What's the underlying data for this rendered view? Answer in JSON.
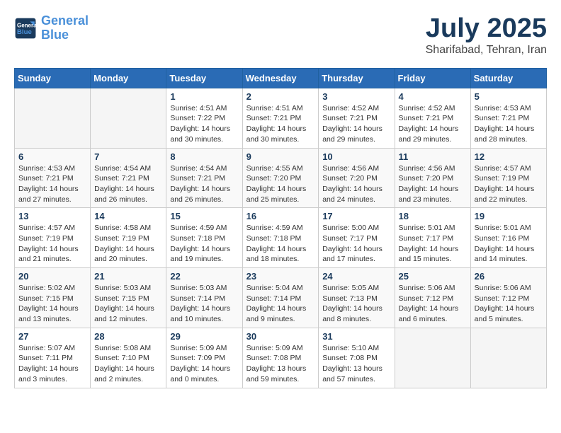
{
  "header": {
    "logo_line1": "General",
    "logo_line2": "Blue",
    "month": "July 2025",
    "location": "Sharifabad, Tehran, Iran"
  },
  "weekdays": [
    "Sunday",
    "Monday",
    "Tuesday",
    "Wednesday",
    "Thursday",
    "Friday",
    "Saturday"
  ],
  "weeks": [
    [
      {
        "day": "",
        "sunrise": "",
        "sunset": "",
        "daylight": ""
      },
      {
        "day": "",
        "sunrise": "",
        "sunset": "",
        "daylight": ""
      },
      {
        "day": "1",
        "sunrise": "Sunrise: 4:51 AM",
        "sunset": "Sunset: 7:22 PM",
        "daylight": "Daylight: 14 hours and 30 minutes."
      },
      {
        "day": "2",
        "sunrise": "Sunrise: 4:51 AM",
        "sunset": "Sunset: 7:21 PM",
        "daylight": "Daylight: 14 hours and 30 minutes."
      },
      {
        "day": "3",
        "sunrise": "Sunrise: 4:52 AM",
        "sunset": "Sunset: 7:21 PM",
        "daylight": "Daylight: 14 hours and 29 minutes."
      },
      {
        "day": "4",
        "sunrise": "Sunrise: 4:52 AM",
        "sunset": "Sunset: 7:21 PM",
        "daylight": "Daylight: 14 hours and 29 minutes."
      },
      {
        "day": "5",
        "sunrise": "Sunrise: 4:53 AM",
        "sunset": "Sunset: 7:21 PM",
        "daylight": "Daylight: 14 hours and 28 minutes."
      }
    ],
    [
      {
        "day": "6",
        "sunrise": "Sunrise: 4:53 AM",
        "sunset": "Sunset: 7:21 PM",
        "daylight": "Daylight: 14 hours and 27 minutes."
      },
      {
        "day": "7",
        "sunrise": "Sunrise: 4:54 AM",
        "sunset": "Sunset: 7:21 PM",
        "daylight": "Daylight: 14 hours and 26 minutes."
      },
      {
        "day": "8",
        "sunrise": "Sunrise: 4:54 AM",
        "sunset": "Sunset: 7:21 PM",
        "daylight": "Daylight: 14 hours and 26 minutes."
      },
      {
        "day": "9",
        "sunrise": "Sunrise: 4:55 AM",
        "sunset": "Sunset: 7:20 PM",
        "daylight": "Daylight: 14 hours and 25 minutes."
      },
      {
        "day": "10",
        "sunrise": "Sunrise: 4:56 AM",
        "sunset": "Sunset: 7:20 PM",
        "daylight": "Daylight: 14 hours and 24 minutes."
      },
      {
        "day": "11",
        "sunrise": "Sunrise: 4:56 AM",
        "sunset": "Sunset: 7:20 PM",
        "daylight": "Daylight: 14 hours and 23 minutes."
      },
      {
        "day": "12",
        "sunrise": "Sunrise: 4:57 AM",
        "sunset": "Sunset: 7:19 PM",
        "daylight": "Daylight: 14 hours and 22 minutes."
      }
    ],
    [
      {
        "day": "13",
        "sunrise": "Sunrise: 4:57 AM",
        "sunset": "Sunset: 7:19 PM",
        "daylight": "Daylight: 14 hours and 21 minutes."
      },
      {
        "day": "14",
        "sunrise": "Sunrise: 4:58 AM",
        "sunset": "Sunset: 7:19 PM",
        "daylight": "Daylight: 14 hours and 20 minutes."
      },
      {
        "day": "15",
        "sunrise": "Sunrise: 4:59 AM",
        "sunset": "Sunset: 7:18 PM",
        "daylight": "Daylight: 14 hours and 19 minutes."
      },
      {
        "day": "16",
        "sunrise": "Sunrise: 4:59 AM",
        "sunset": "Sunset: 7:18 PM",
        "daylight": "Daylight: 14 hours and 18 minutes."
      },
      {
        "day": "17",
        "sunrise": "Sunrise: 5:00 AM",
        "sunset": "Sunset: 7:17 PM",
        "daylight": "Daylight: 14 hours and 17 minutes."
      },
      {
        "day": "18",
        "sunrise": "Sunrise: 5:01 AM",
        "sunset": "Sunset: 7:17 PM",
        "daylight": "Daylight: 14 hours and 15 minutes."
      },
      {
        "day": "19",
        "sunrise": "Sunrise: 5:01 AM",
        "sunset": "Sunset: 7:16 PM",
        "daylight": "Daylight: 14 hours and 14 minutes."
      }
    ],
    [
      {
        "day": "20",
        "sunrise": "Sunrise: 5:02 AM",
        "sunset": "Sunset: 7:15 PM",
        "daylight": "Daylight: 14 hours and 13 minutes."
      },
      {
        "day": "21",
        "sunrise": "Sunrise: 5:03 AM",
        "sunset": "Sunset: 7:15 PM",
        "daylight": "Daylight: 14 hours and 12 minutes."
      },
      {
        "day": "22",
        "sunrise": "Sunrise: 5:03 AM",
        "sunset": "Sunset: 7:14 PM",
        "daylight": "Daylight: 14 hours and 10 minutes."
      },
      {
        "day": "23",
        "sunrise": "Sunrise: 5:04 AM",
        "sunset": "Sunset: 7:14 PM",
        "daylight": "Daylight: 14 hours and 9 minutes."
      },
      {
        "day": "24",
        "sunrise": "Sunrise: 5:05 AM",
        "sunset": "Sunset: 7:13 PM",
        "daylight": "Daylight: 14 hours and 8 minutes."
      },
      {
        "day": "25",
        "sunrise": "Sunrise: 5:06 AM",
        "sunset": "Sunset: 7:12 PM",
        "daylight": "Daylight: 14 hours and 6 minutes."
      },
      {
        "day": "26",
        "sunrise": "Sunrise: 5:06 AM",
        "sunset": "Sunset: 7:12 PM",
        "daylight": "Daylight: 14 hours and 5 minutes."
      }
    ],
    [
      {
        "day": "27",
        "sunrise": "Sunrise: 5:07 AM",
        "sunset": "Sunset: 7:11 PM",
        "daylight": "Daylight: 14 hours and 3 minutes."
      },
      {
        "day": "28",
        "sunrise": "Sunrise: 5:08 AM",
        "sunset": "Sunset: 7:10 PM",
        "daylight": "Daylight: 14 hours and 2 minutes."
      },
      {
        "day": "29",
        "sunrise": "Sunrise: 5:09 AM",
        "sunset": "Sunset: 7:09 PM",
        "daylight": "Daylight: 14 hours and 0 minutes."
      },
      {
        "day": "30",
        "sunrise": "Sunrise: 5:09 AM",
        "sunset": "Sunset: 7:08 PM",
        "daylight": "Daylight: 13 hours and 59 minutes."
      },
      {
        "day": "31",
        "sunrise": "Sunrise: 5:10 AM",
        "sunset": "Sunset: 7:08 PM",
        "daylight": "Daylight: 13 hours and 57 minutes."
      },
      {
        "day": "",
        "sunrise": "",
        "sunset": "",
        "daylight": ""
      },
      {
        "day": "",
        "sunrise": "",
        "sunset": "",
        "daylight": ""
      }
    ]
  ]
}
